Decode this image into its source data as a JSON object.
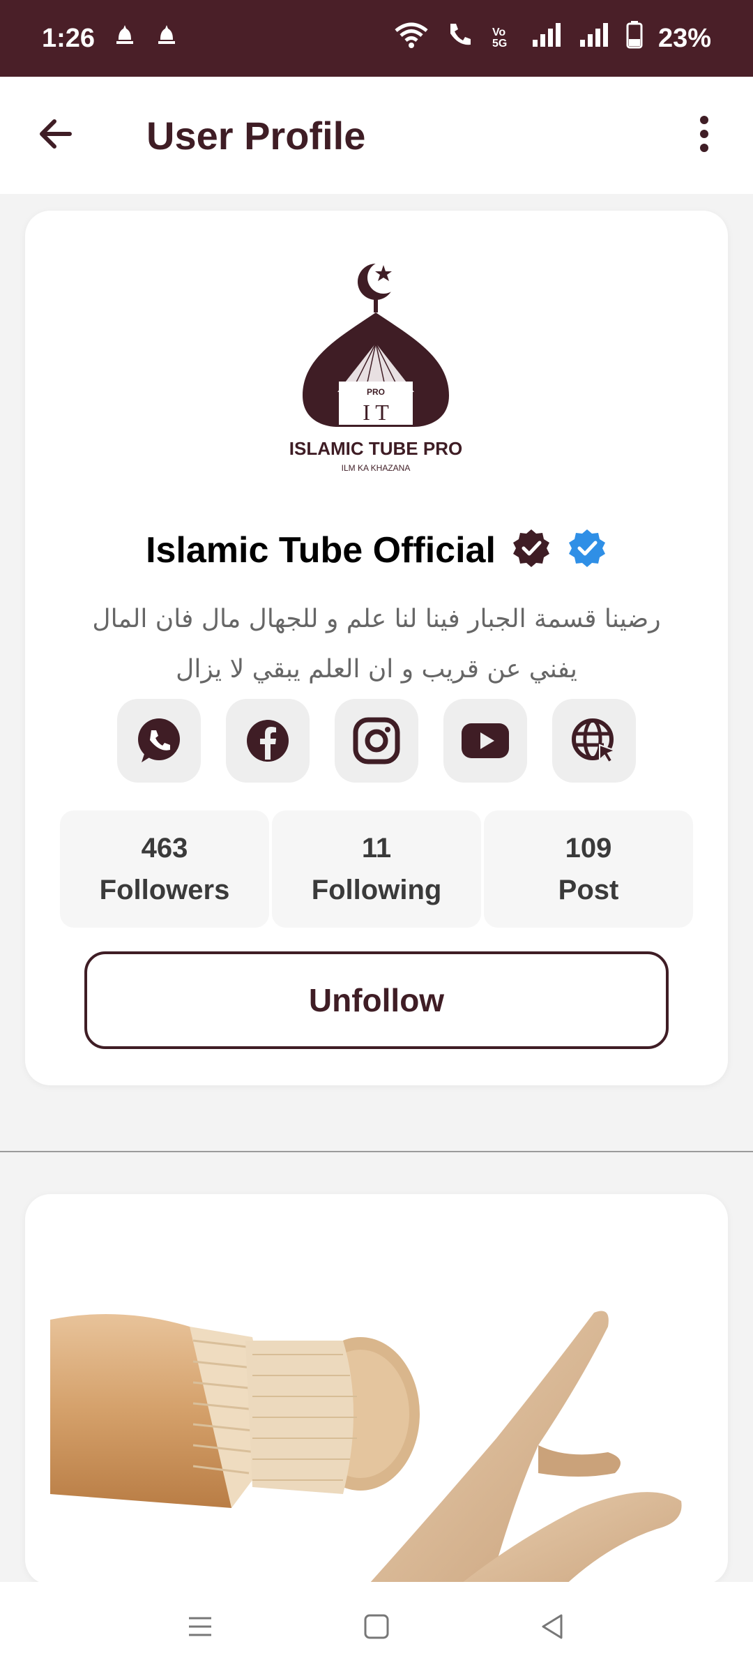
{
  "status_bar": {
    "time": "1:26",
    "battery": "23%",
    "volte": "Vo 5G"
  },
  "app_bar": {
    "title": "User Profile"
  },
  "profile": {
    "logo": {
      "badge": "PRO",
      "letters": "I T",
      "brand": "ISLAMIC TUBE PRO",
      "tagline": "ILM KA KHAZANA"
    },
    "name": "Islamic Tube Official",
    "bio": "رضينا قسمة الجبار فينا لنا علم و للجهال مال فان المال يفني عن قريب و ان العلم يبقي لا يزال",
    "socials": [
      "whatsapp-icon",
      "facebook-icon",
      "instagram-icon",
      "youtube-icon",
      "website-icon"
    ],
    "stats": [
      {
        "value": "463",
        "label": "Followers"
      },
      {
        "value": "11",
        "label": "Following"
      },
      {
        "value": "109",
        "label": "Post"
      }
    ],
    "unfollow_label": "Unfollow"
  },
  "colors": {
    "brand": "#3f1d25",
    "status_bar": "#4a1f28",
    "verified_blue": "#2f8fe6"
  }
}
